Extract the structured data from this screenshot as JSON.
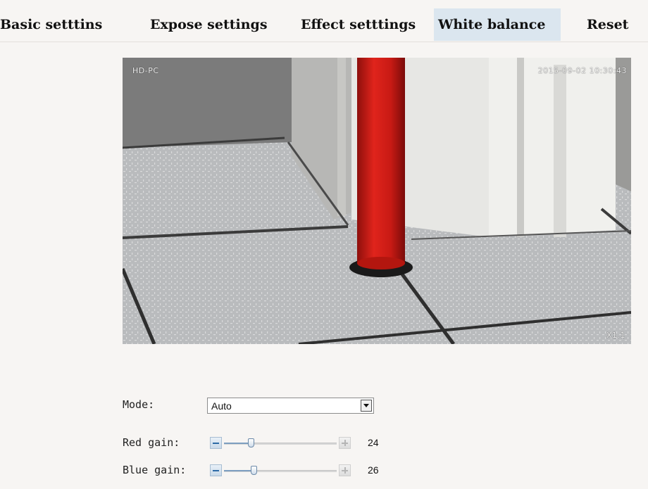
{
  "tabs": [
    {
      "label": "Basic setttins",
      "active": false
    },
    {
      "label": "Expose settings",
      "active": false
    },
    {
      "label": "Effect setttings",
      "active": false
    },
    {
      "label": "White balance",
      "active": true
    },
    {
      "label": "Reset",
      "active": false
    }
  ],
  "preview": {
    "camera_name": "HD-PC",
    "timestamp": "2015-09-02 10:30:43",
    "zoom": "X1.1"
  },
  "controls": {
    "mode": {
      "label": "Mode:",
      "value": "Auto"
    },
    "red_gain": {
      "label": "Red gain:",
      "value": "24",
      "level": 0.24
    },
    "blue_gain": {
      "label": "Blue gain:",
      "value": "26",
      "level": 0.26
    }
  },
  "colors": {
    "active_tab_bg": "#dbe6ef",
    "page_bg": "#f7f5f3",
    "pipe_red": "#d01a14"
  },
  "icons": [
    "dropdown-arrow-icon",
    "minus-icon",
    "plus-icon"
  ]
}
